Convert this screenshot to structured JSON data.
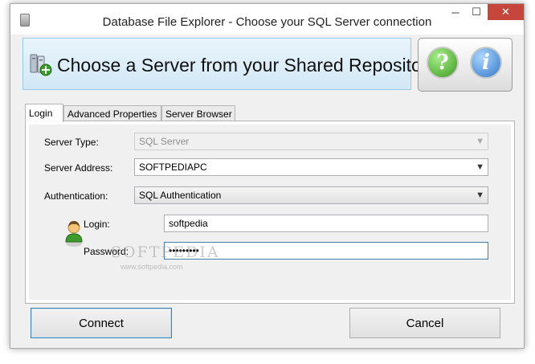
{
  "window": {
    "title": "Database File Explorer - Choose your SQL Server connection",
    "controls": {
      "minimize": "─",
      "maximize": "☐",
      "close": "✕"
    }
  },
  "banner": {
    "title": "Choose a Server from your Shared Repository",
    "icon": "server-add-icon"
  },
  "help_buttons": {
    "help": "?",
    "info": "i"
  },
  "tabs": [
    {
      "label": "Login",
      "active": true
    },
    {
      "label": "Advanced Properties",
      "active": false
    },
    {
      "label": "Server Browser",
      "active": false
    }
  ],
  "form": {
    "server_type": {
      "label": "Server Type:",
      "value": "SQL Server",
      "disabled": true
    },
    "server_address": {
      "label": "Server Address:",
      "value": "SOFTPEDIAPC"
    },
    "authentication": {
      "label": "Authentication:",
      "value": "SQL Authentication"
    },
    "login": {
      "label": "Login:",
      "value": "softpedia"
    },
    "password": {
      "label": "Password:",
      "value": "•••••••••"
    }
  },
  "watermark": {
    "text": "SOFTPEDIA",
    "sub": "www.softpedia.com"
  },
  "buttons": {
    "connect": "Connect",
    "cancel": "Cancel"
  },
  "colors": {
    "accent": "#3c7fb1",
    "banner_bg": "#e0eff9",
    "close": "#c7463c"
  }
}
